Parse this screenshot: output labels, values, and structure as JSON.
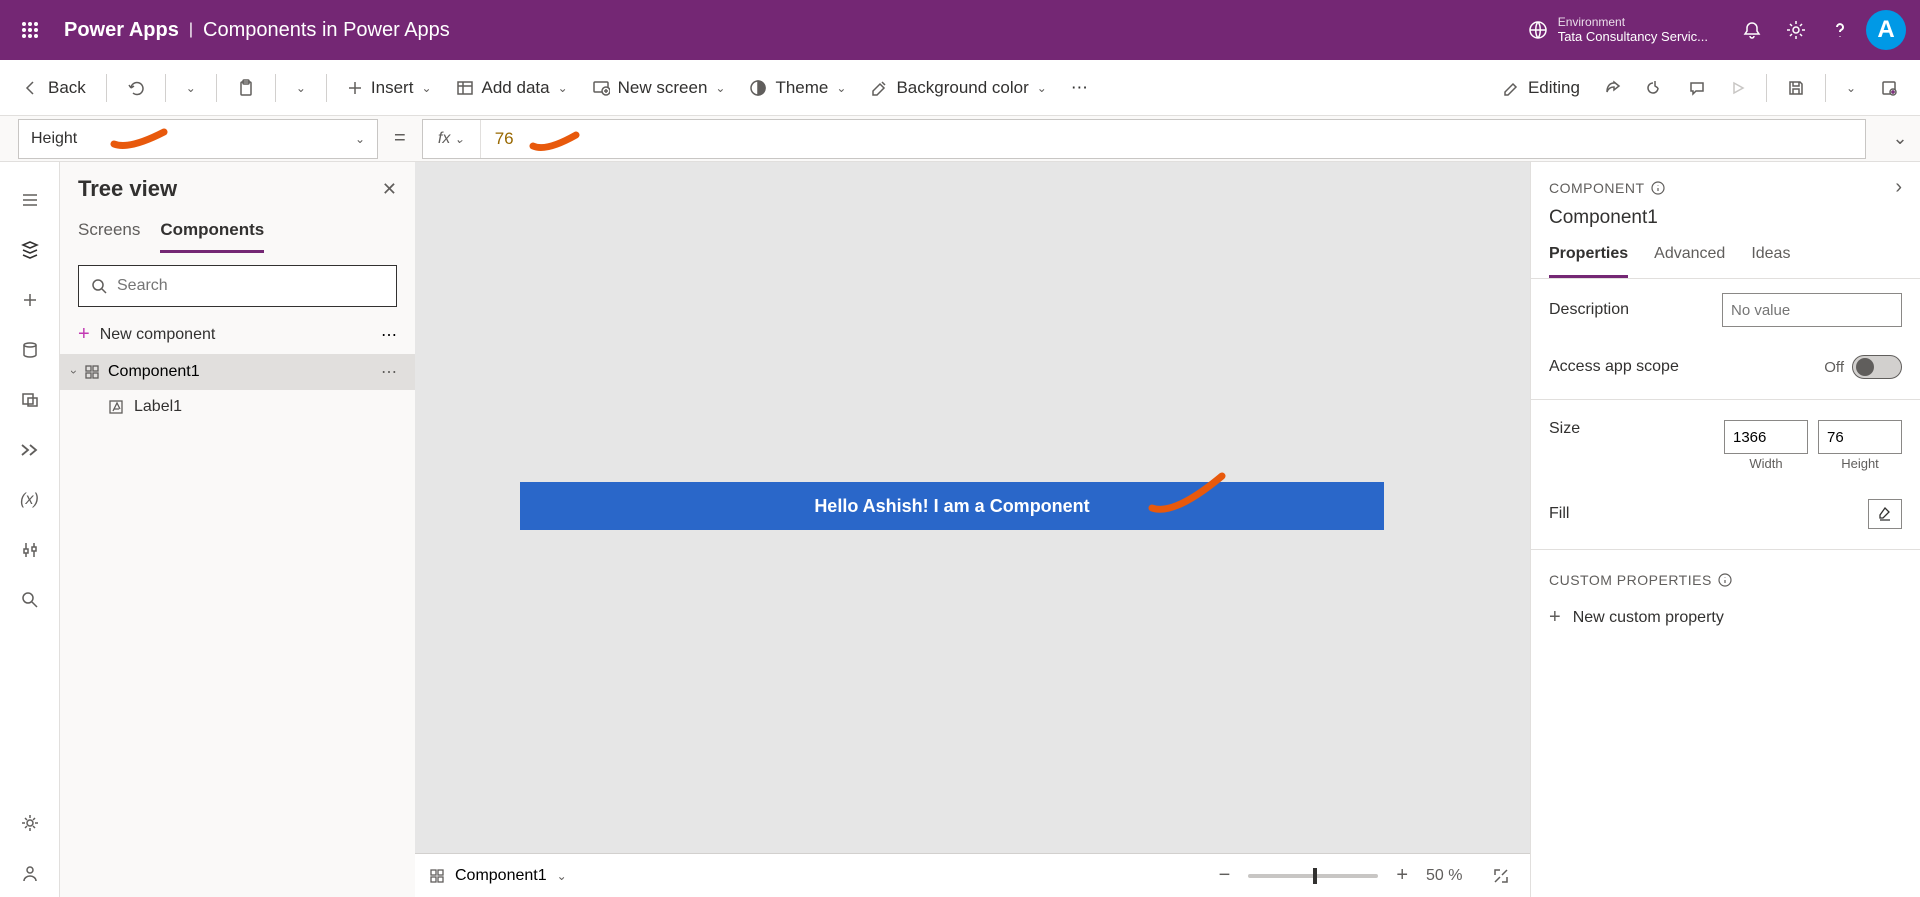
{
  "top": {
    "brand": "Power Apps",
    "appname": "Components in Power Apps",
    "env_label": "Environment",
    "env_name": "Tata Consultancy Servic...",
    "avatar": "A"
  },
  "cmd": {
    "back": "Back",
    "insert": "Insert",
    "add_data": "Add data",
    "new_screen": "New screen",
    "theme": "Theme",
    "bg_color": "Background color",
    "editing": "Editing"
  },
  "formula": {
    "property": "Height",
    "value": "76"
  },
  "tree": {
    "title": "Tree view",
    "tab_screens": "Screens",
    "tab_components": "Components",
    "search_placeholder": "Search",
    "new_component": "New component",
    "items": [
      {
        "name": "Component1",
        "children": [
          {
            "name": "Label1"
          }
        ]
      }
    ]
  },
  "canvas": {
    "label_text": "Hello Ashish! I am a Component",
    "breadcrumb": "Component1",
    "zoom": "50  %"
  },
  "props": {
    "section": "COMPONENT",
    "name": "Component1",
    "tab_properties": "Properties",
    "tab_advanced": "Advanced",
    "tab_ideas": "Ideas",
    "description": "Description",
    "desc_placeholder": "No value",
    "access_scope": "Access app scope",
    "access_off": "Off",
    "size": "Size",
    "width_val": "1366",
    "height_val": "76",
    "width_lbl": "Width",
    "height_lbl": "Height",
    "fill": "Fill",
    "custom_props": "CUSTOM PROPERTIES",
    "new_custom": "New custom property"
  }
}
